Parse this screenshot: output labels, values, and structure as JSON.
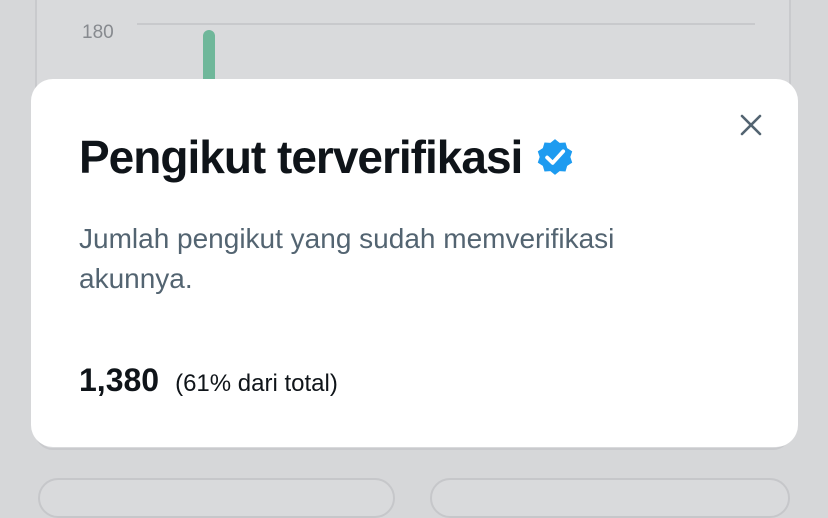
{
  "background": {
    "y_tick_label": "180",
    "bar_color": "#6fb79a"
  },
  "modal": {
    "title": "Pengikut terverifikasi",
    "title_icon": "verified-badge-icon",
    "close_icon": "close-icon",
    "description": "Jumlah pengikut yang sudah memverifikasi akunnya.",
    "stat_value": "1,380",
    "stat_percent": "(61% dari total)",
    "accent_color": "#1d9bf0"
  }
}
